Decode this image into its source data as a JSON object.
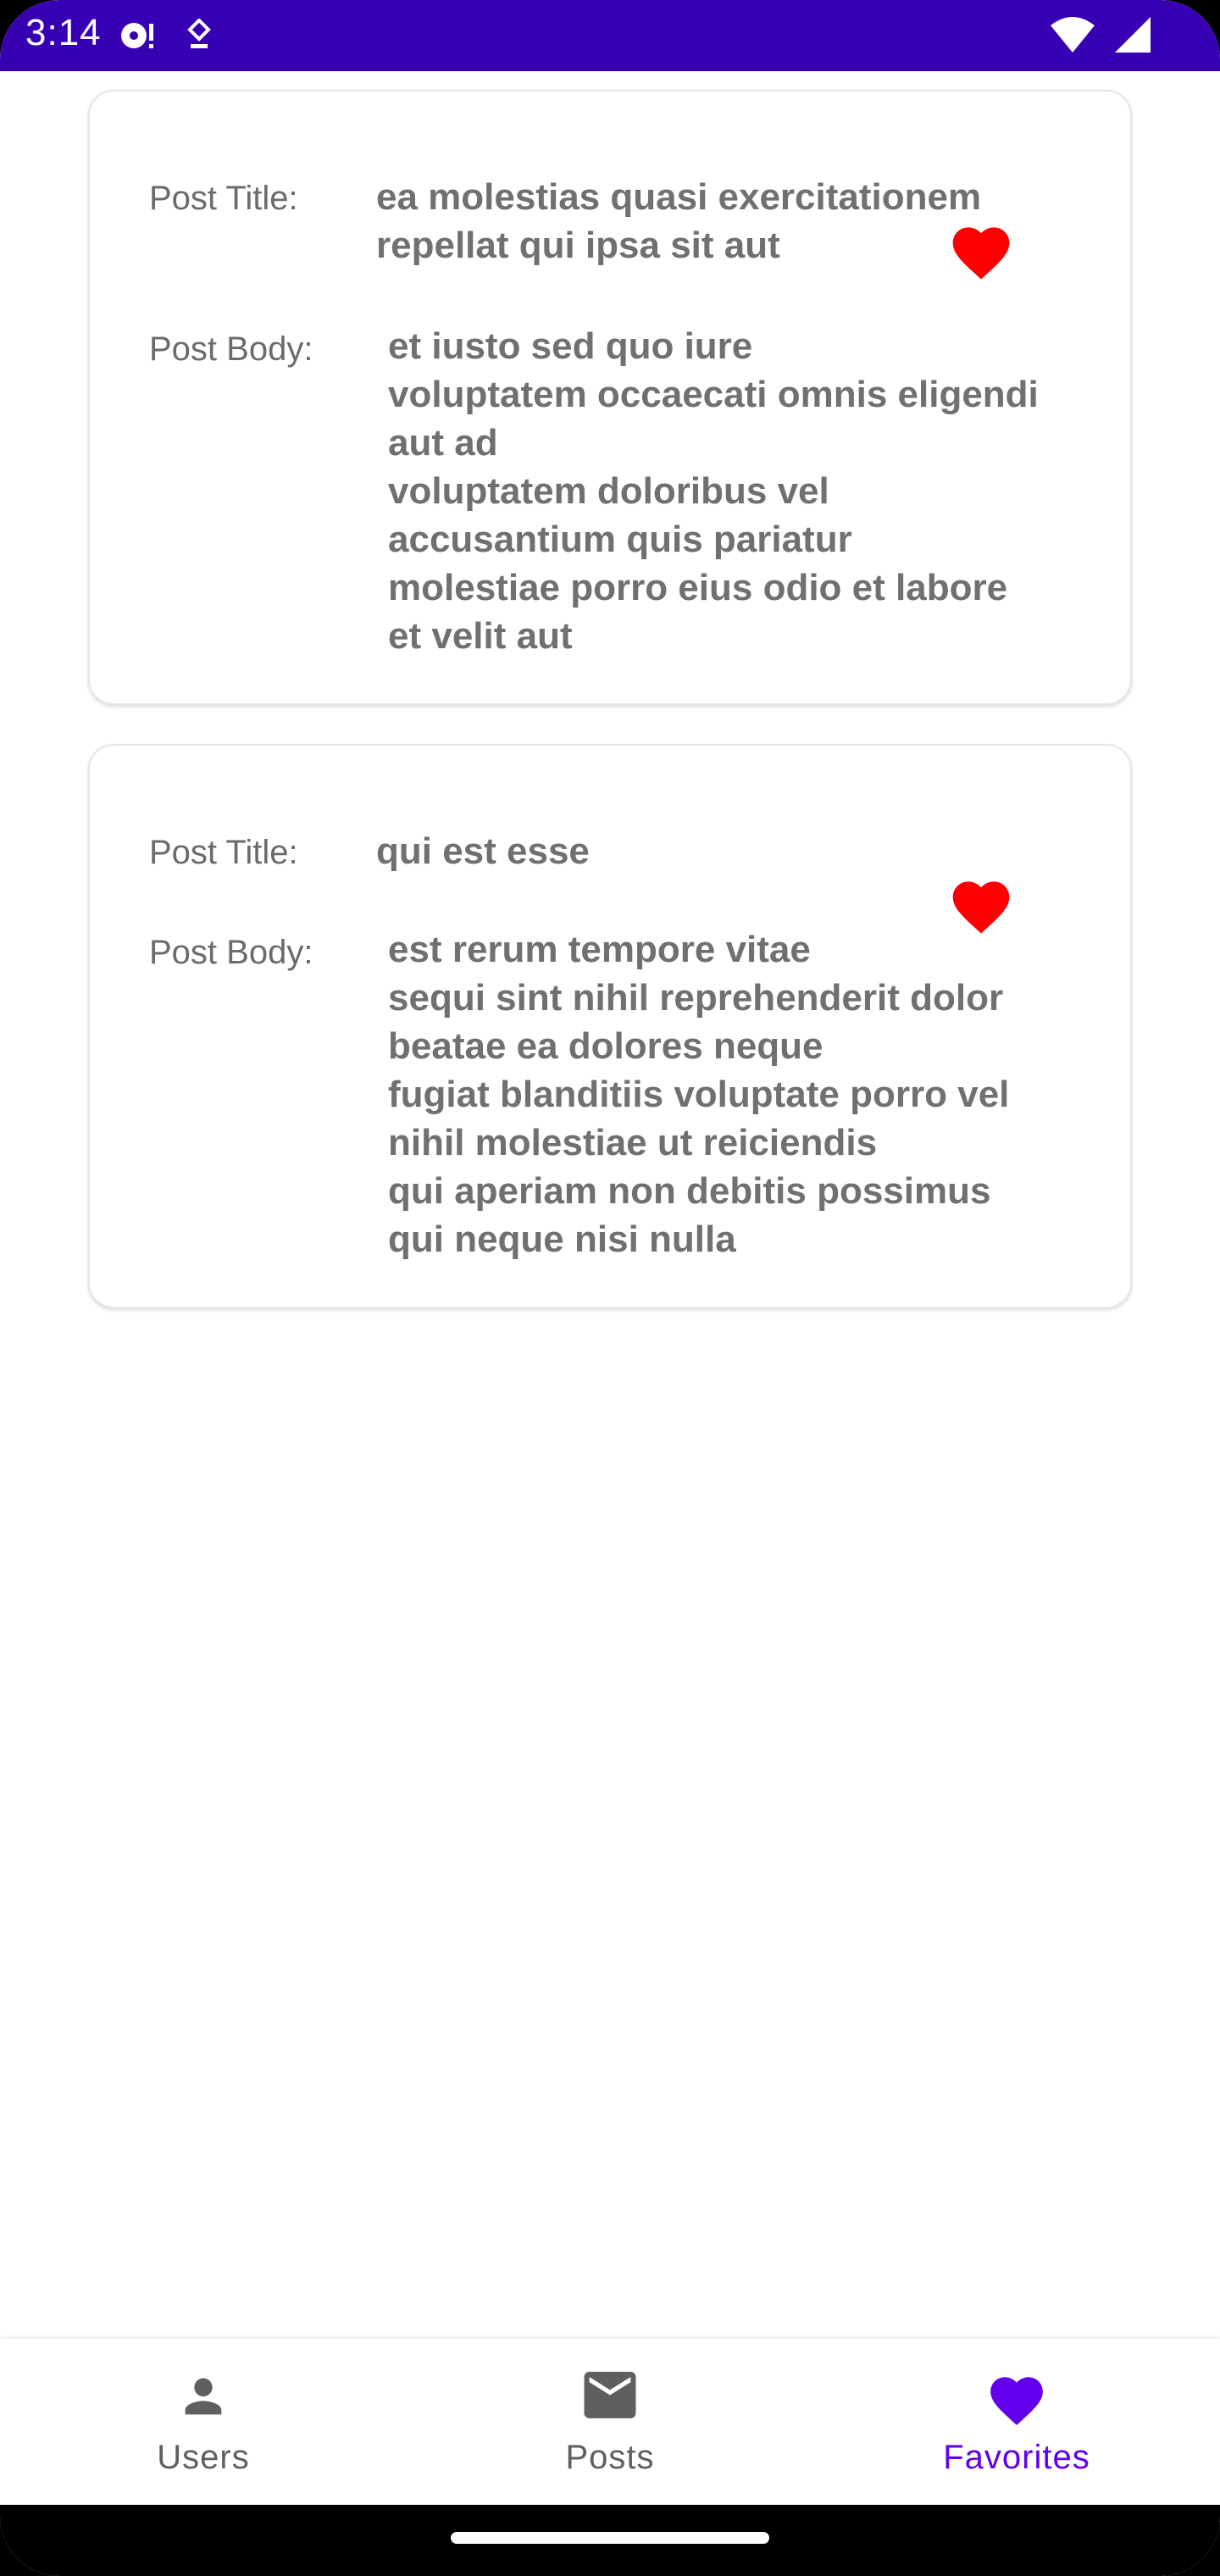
{
  "status_bar": {
    "time": "3:14",
    "icons": [
      "media-sync-icon",
      "location-icon",
      "wifi-icon",
      "signal-icon"
    ],
    "background": "#3700B3"
  },
  "labels": {
    "post_title": "Post Title:",
    "post_body": "Post Body:"
  },
  "posts": [
    {
      "title_lines": [
        "ea molestias quasi exercitationem",
        "repellat qui ipsa sit aut"
      ],
      "body_lines": [
        "et iusto sed quo iure",
        "voluptatem occaecati omnis eligendi",
        "aut ad",
        "voluptatem doloribus vel",
        "accusantium quis pariatur",
        "molestiae porro eius odio et labore",
        "et velit aut"
      ],
      "favorite_icon": "heart-icon"
    },
    {
      "title_lines": [
        "qui est esse"
      ],
      "body_lines": [
        "est rerum tempore vitae",
        "sequi sint nihil reprehenderit dolor",
        "beatae ea dolores neque",
        "fugiat blanditiis voluptate porro vel",
        "nihil molestiae ut reiciendis",
        "qui aperiam non debitis possimus",
        "qui neque nisi nulla"
      ],
      "favorite_icon": "heart-icon"
    }
  ],
  "bottom_nav": {
    "items": [
      {
        "label": "Users",
        "icon": "person-icon",
        "active": false
      },
      {
        "label": "Posts",
        "icon": "mail-icon",
        "active": false
      },
      {
        "label": "Favorites",
        "icon": "heart-icon",
        "active": true
      }
    ]
  },
  "colors": {
    "accent": "#6200EE",
    "favorite": "#FF0000",
    "text_value": "#707070",
    "text_label": "#6b6b6b",
    "nav_inactive": "#5f5f5f"
  }
}
